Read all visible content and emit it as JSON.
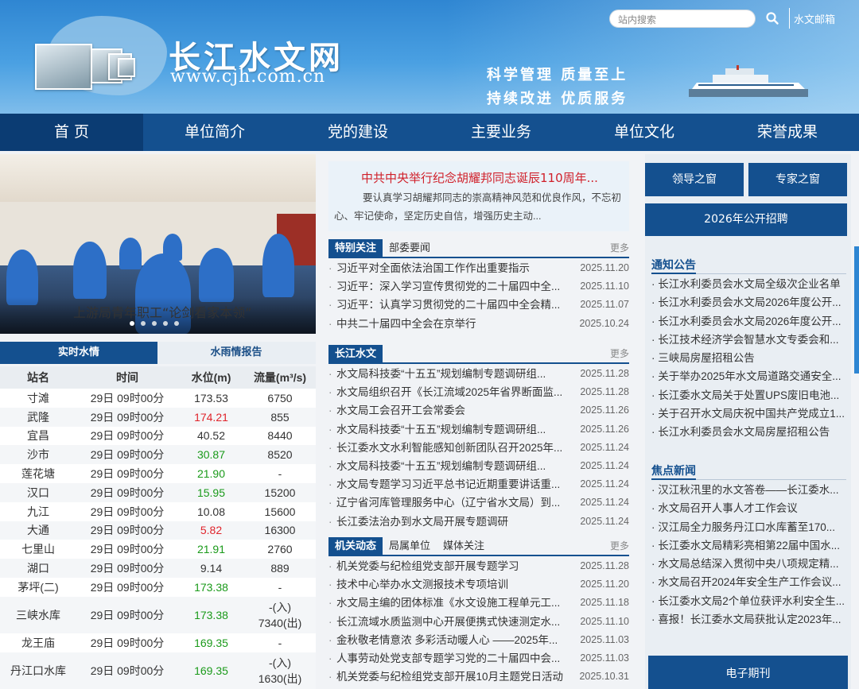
{
  "header": {
    "site_title": "长江水文网",
    "site_url": "www.cjh.com.cn",
    "slogan_line1": "科学管理  质量至上",
    "slogan_line2": "持续改进  优质服务",
    "search_placeholder": "站内搜索",
    "mail_link": "水文邮箱"
  },
  "nav": [
    "首 页",
    "单位简介",
    "党的建设",
    "主要业务",
    "单位文化",
    "荣誉成果"
  ],
  "slider": {
    "caption": "上游局青年职工“论剑看家本领”",
    "dot_count": 5,
    "active_dot": 0
  },
  "water": {
    "tabs": [
      "实时水情",
      "水雨情报告"
    ],
    "columns": [
      "站名",
      "时间",
      "水位(m)",
      "流量(m³/s)"
    ],
    "rows": [
      {
        "station": "寸滩",
        "time": "29日 09时00分",
        "level": "173.53",
        "flow": "6750",
        "level_color": "#333333"
      },
      {
        "station": "武隆",
        "time": "29日 09时00分",
        "level": "174.21",
        "flow": "855",
        "level_color": "#e0242b"
      },
      {
        "station": "宜昌",
        "time": "29日 09时00分",
        "level": "40.52",
        "flow": "8440",
        "level_color": "#333333"
      },
      {
        "station": "沙市",
        "time": "29日 09时00分",
        "level": "30.87",
        "flow": "8520",
        "level_color": "#1a9a1a"
      },
      {
        "station": "莲花塘",
        "time": "29日 09时00分",
        "level": "21.90",
        "flow": "-",
        "level_color": "#1a9a1a"
      },
      {
        "station": "汉口",
        "time": "29日 09时00分",
        "level": "15.95",
        "flow": "15200",
        "level_color": "#1a9a1a"
      },
      {
        "station": "九江",
        "time": "29日 09时00分",
        "level": "10.08",
        "flow": "15600",
        "level_color": "#333333"
      },
      {
        "station": "大通",
        "time": "29日 09时00分",
        "level": "5.82",
        "flow": "16300",
        "level_color": "#e0242b"
      },
      {
        "station": "七里山",
        "time": "29日 09时00分",
        "level": "21.91",
        "flow": "2760",
        "level_color": "#1a9a1a"
      },
      {
        "station": "湖口",
        "time": "29日 09时00分",
        "level": "9.14",
        "flow": "889",
        "level_color": "#333333"
      },
      {
        "station": "茅坪(二)",
        "time": "29日 09时00分",
        "level": "173.38",
        "flow": "-",
        "level_color": "#1a9a1a"
      },
      {
        "station": "三峡水库",
        "time": "29日 09时00分",
        "level": "173.38",
        "flow": "-(入)\n7340(出)",
        "level_color": "#1a9a1a"
      },
      {
        "station": "龙王庙",
        "time": "29日 09时00分",
        "level": "169.35",
        "flow": "-",
        "level_color": "#1a9a1a"
      },
      {
        "station": "丹江口水库",
        "time": "29日 09时00分",
        "level": "169.35",
        "flow": "-(入)\n1630(出)",
        "level_color": "#1a9a1a"
      }
    ]
  },
  "headline": {
    "title": "中共中央举行纪念胡耀邦同志诞辰110周年...",
    "text": "要认真学习胡耀邦同志的崇高精神风范和优良作风，不忘初心、牢记使命，坚定历史自信，增强历史主动..."
  },
  "panel1": {
    "tabs": [
      "特别关注",
      "部委要闻"
    ],
    "more": "更多",
    "items": [
      {
        "title": "习近平对全面依法治国工作作出重要指示",
        "date": "2025.11.20"
      },
      {
        "title": "习近平：深入学习宣传贯彻党的二十届四中全...",
        "date": "2025.11.10"
      },
      {
        "title": "习近平：认真学习贯彻党的二十届四中全会精...",
        "date": "2025.11.07"
      },
      {
        "title": "中共二十届四中全会在京举行",
        "date": "2025.10.24"
      }
    ]
  },
  "panel2": {
    "tabs": [
      "长江水文"
    ],
    "more": "更多",
    "items": [
      {
        "title": "水文局科技委“十五五”规划编制专题调研组...",
        "date": "2025.11.28"
      },
      {
        "title": "水文局组织召开《长江流域2025年省界断面监...",
        "date": "2025.11.28"
      },
      {
        "title": "水文局工会召开工会常委会",
        "date": "2025.11.26"
      },
      {
        "title": "水文局科技委“十五五”规划编制专题调研组...",
        "date": "2025.11.26"
      },
      {
        "title": "长江委水文水利智能感知创新团队召开2025年...",
        "date": "2025.11.24"
      },
      {
        "title": "水文局科技委“十五五”规划编制专题调研组...",
        "date": "2025.11.24"
      },
      {
        "title": "水文局专题学习习近平总书记近期重要讲话重...",
        "date": "2025.11.24"
      },
      {
        "title": "辽宁省河库管理服务中心（辽宁省水文局）到...",
        "date": "2025.11.24"
      },
      {
        "title": "长江委法治办到水文局开展专题调研",
        "date": "2025.11.24"
      }
    ]
  },
  "panel3": {
    "tabs": [
      "机关动态",
      "局属单位",
      "媒体关注"
    ],
    "more": "更多",
    "items": [
      {
        "title": "机关党委与纪检组党支部开展专题学习",
        "date": "2025.11.28"
      },
      {
        "title": "技术中心举办水文测报技术专项培训",
        "date": "2025.11.20"
      },
      {
        "title": "水文局主编的团体标准《水文设施工程单元工...",
        "date": "2025.11.18"
      },
      {
        "title": "长江流域水质监测中心开展便携式快速测定水...",
        "date": "2025.11.10"
      },
      {
        "title": "金秋敬老情意浓 多彩活动暖人心 ——2025年...",
        "date": "2025.11.03"
      },
      {
        "title": "人事劳动处党支部专题学习党的二十届四中会...",
        "date": "2025.11.03"
      },
      {
        "title": "机关党委与纪检组党支部开展10月主题党日活动",
        "date": "2025.10.31"
      }
    ]
  },
  "right": {
    "btn_leaders": "领导之窗",
    "btn_experts": "专家之窗",
    "btn_recruit": "2026年公开招聘",
    "notice_title": "通知公告",
    "notices": [
      "· 长江水利委员会水文局全级次企业名单",
      "· 长江水利委员会水文局2026年度公开...",
      "· 长江水利委员会水文局2026年度公开...",
      "· 长江技术经济学会智慧水文专委会和...",
      "· 三峡局房屋招租公告",
      "· 关于举办2025年水文局道路交通安全...",
      "· 长江委水文局关于处置UPS废旧电池...",
      "· 关于召开水文局庆祝中国共产党成立1...",
      "· 长江水利委员会水文局房屋招租公告"
    ],
    "focus_title": "焦点新闻",
    "focus": [
      "· 汉江秋汛里的水文答卷——长江委水...",
      "· 水文局召开人事人才工作会议",
      "· 汉江局全力服务丹江口水库蓄至170...",
      "· 长江委水文局精彩亮相第22届中国水...",
      "· 水文局总结深入贯彻中央八项规定精...",
      "· 水文局召开2024年安全生产工作会议...",
      "· 长江委水文局2个单位获评水利安全生...",
      "· 喜报！长江委水文局获批认定2023年..."
    ],
    "ejournal": "电子期刊"
  }
}
